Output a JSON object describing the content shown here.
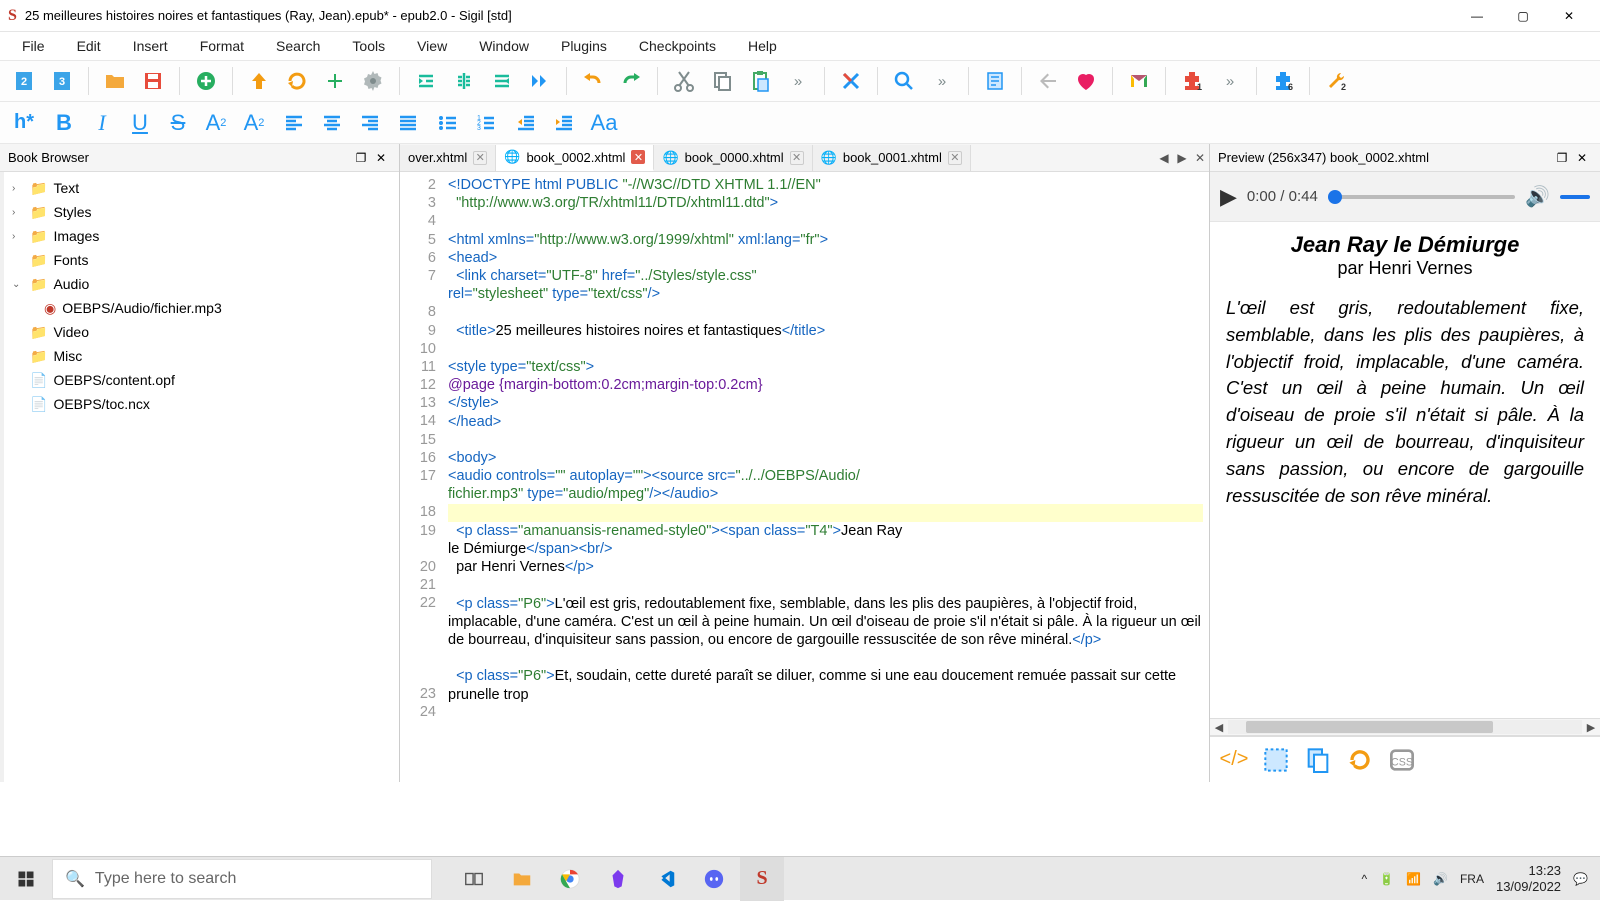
{
  "titlebar": {
    "app_icon": "S",
    "title": "25 meilleures histoires noires et fantastiques (Ray, Jean).epub* - epub2.0 - Sigil [std]"
  },
  "menubar": [
    "File",
    "Edit",
    "Insert",
    "Format",
    "Search",
    "Tools",
    "View",
    "Window",
    "Plugins",
    "Checkpoints",
    "Help"
  ],
  "book_browser": {
    "title": "Book Browser",
    "items": [
      {
        "label": "Text",
        "type": "folder",
        "expand": ">"
      },
      {
        "label": "Styles",
        "type": "folder",
        "expand": ">"
      },
      {
        "label": "Images",
        "type": "folder",
        "expand": ">"
      },
      {
        "label": "Fonts",
        "type": "folder",
        "expand": ""
      },
      {
        "label": "Audio",
        "type": "folder",
        "expand": "v"
      },
      {
        "label": "OEBPS/Audio/fichier.mp3",
        "type": "file-audio",
        "child": true
      },
      {
        "label": "Video",
        "type": "folder",
        "expand": ""
      },
      {
        "label": "Misc",
        "type": "folder",
        "expand": ""
      },
      {
        "label": "OEBPS/content.opf",
        "type": "file",
        "expand": ""
      },
      {
        "label": "OEBPS/toc.ncx",
        "type": "file",
        "expand": ""
      }
    ]
  },
  "tabs": [
    {
      "label": "over.xhtml",
      "active": false,
      "close": "normal",
      "truncated": true
    },
    {
      "label": "book_0002.xhtml",
      "active": true,
      "close": "red"
    },
    {
      "label": "book_0000.xhtml",
      "active": false,
      "close": "normal"
    },
    {
      "label": "book_0001.xhtml",
      "active": false,
      "close": "normal"
    }
  ],
  "gutter": [
    "2",
    "3",
    "4",
    "5",
    "6",
    "7",
    "",
    "8",
    "9",
    "10",
    "11",
    "12",
    "13",
    "14",
    "15",
    "16",
    "17",
    "",
    "18",
    "19",
    "",
    "20",
    "21",
    "22",
    "",
    "",
    "",
    "",
    "23",
    "24",
    ""
  ],
  "code": {
    "l2a": "<!DOCTYPE html PUBLIC ",
    "l2b": "\"-//W3C//DTD XHTML 1.1//EN\"",
    "l3": "\"http://www.w3.org/TR/xhtml11/DTD/xhtml11.dtd\"",
    "l3b": ">",
    "l5a": "<html ",
    "l5b": "xmlns=",
    "l5c": "\"http://www.w3.org/1999/xhtml\"",
    "l5d": " xml:lang=",
    "l5e": "\"fr\"",
    "l5f": ">",
    "l6": "<head>",
    "l7a": "  <link ",
    "l7b": "charset=",
    "l7c": "\"UTF-8\"",
    "l7d": " href=",
    "l7e": "\"../Styles/style.css\"",
    "l7f": " rel=",
    "l7g": "\"stylesheet\"",
    "l7h": " type=",
    "l7i": "\"text/css\"",
    "l7j": "/>",
    "l9a": "  <title>",
    "l9b": "25 meilleures histoires noires et fantastiques",
    "l9c": "</title>",
    "l11a": "<style ",
    "l11b": "type=",
    "l11c": "\"text/css\"",
    "l11d": ">",
    "l12": "@page {margin-bottom:0.2cm;margin-top:0.2cm}",
    "l13": "</style>",
    "l14": "</head>",
    "l16": "<body>",
    "l17a": "<audio ",
    "l17b": "controls=",
    "l17c": "\"\"",
    "l17d": " autoplay=",
    "l17e": "\"\"",
    "l17f": "><source ",
    "l17g": "src=",
    "l17h": "\"../../OEBPS/Audio/fichier.mp3\"",
    "l17i": " type=",
    "l17j": "\"audio/mpeg\"",
    "l17k": "/></audio>",
    "l19a": "  <p ",
    "l19b": "class=",
    "l19c": "\"amanuansis-renamed-style0\"",
    "l19d": "><span ",
    "l19e": "class=",
    "l19f": "\"T4\"",
    "l19g": ">",
    "l19h": "Jean Ray le Démiurge",
    "l19i": "</span><br/>",
    "l20a": "  par Henri Vernes",
    "l20b": "</p>",
    "l22a": "  <p ",
    "l22b": "class=",
    "l22c": "\"P6\"",
    "l22d": ">",
    "l22e": "L'œil est gris, redoutablement fixe, semblable, dans les plis des paupières, à l'objectif froid, implacable, d'une caméra. C'est un œil à peine humain. Un œil d'oiseau de proie s'il n'était si pâle. À la rigueur un œil de bourreau, d'inquisiteur sans passion, ou encore de gargouille ressuscitée de son rêve minéral.",
    "l22f": "</p>",
    "l24a": "  <p ",
    "l24b": "class=",
    "l24c": "\"P6\"",
    "l24d": ">",
    "l24e": "Et, soudain, cette dureté paraît se diluer, comme si une eau doucement remuée passait sur cette prunelle trop"
  },
  "preview": {
    "title": "Preview (256x347) book_0002.xhtml",
    "audio_time": "0:00 / 0:44",
    "h1": "Jean Ray le Démiurge",
    "h2": "par Henri Vernes",
    "para": "L'œil est gris, redoutablement fixe, semblable, dans les plis des paupières, à l'objectif froid, implacable, d'une caméra. C'est un œil à peine humain. Un œil d'oiseau de proie s'il n'était si pâle. À la rigueur un œil de bourreau, d'inquisiteur sans passion, ou encore de gargouille ressuscitée de son rêve minéral."
  },
  "taskbar": {
    "search_placeholder": "Type here to search",
    "lang": "FRA",
    "time": "13:23",
    "date": "13/09/2022"
  },
  "toolbar2_heading": "h*",
  "toolbar2_aa": "Aa"
}
